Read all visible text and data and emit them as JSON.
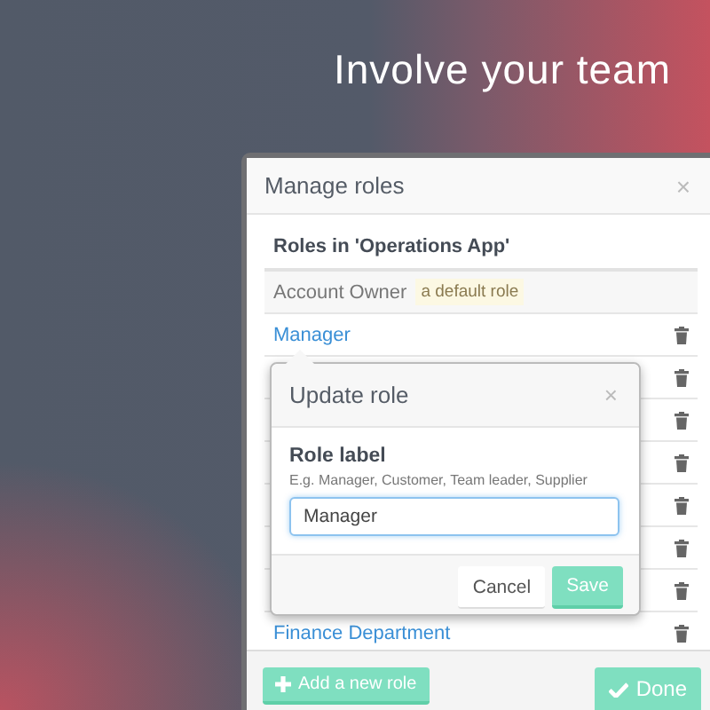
{
  "headline": "Involve your team",
  "dialog": {
    "title": "Manage roles",
    "close": "×",
    "section_title": "Roles in 'Operations App'",
    "roles": [
      {
        "kind": "default",
        "label": "Account Owner",
        "badge": "a default role"
      },
      {
        "kind": "link",
        "label": "Manager"
      },
      {
        "kind": "covered"
      },
      {
        "kind": "covered"
      },
      {
        "kind": "covered"
      },
      {
        "kind": "covered"
      },
      {
        "kind": "covered"
      },
      {
        "kind": "covered"
      },
      {
        "kind": "link",
        "label": "Finance Department"
      }
    ],
    "buttons": [
      {
        "kind": "add",
        "label": "Add a new role"
      },
      {
        "kind": "confirm",
        "label": "Done"
      }
    ]
  },
  "popover": {
    "title": "Update role",
    "close": "×",
    "field_label": "Role label",
    "hint": "E.g. Manager, Customer, Team leader, Supplier",
    "value": "Manager",
    "buttons": [
      {
        "kind": "default",
        "label": "Cancel"
      },
      {
        "kind": "primary",
        "label": "Save"
      }
    ]
  }
}
